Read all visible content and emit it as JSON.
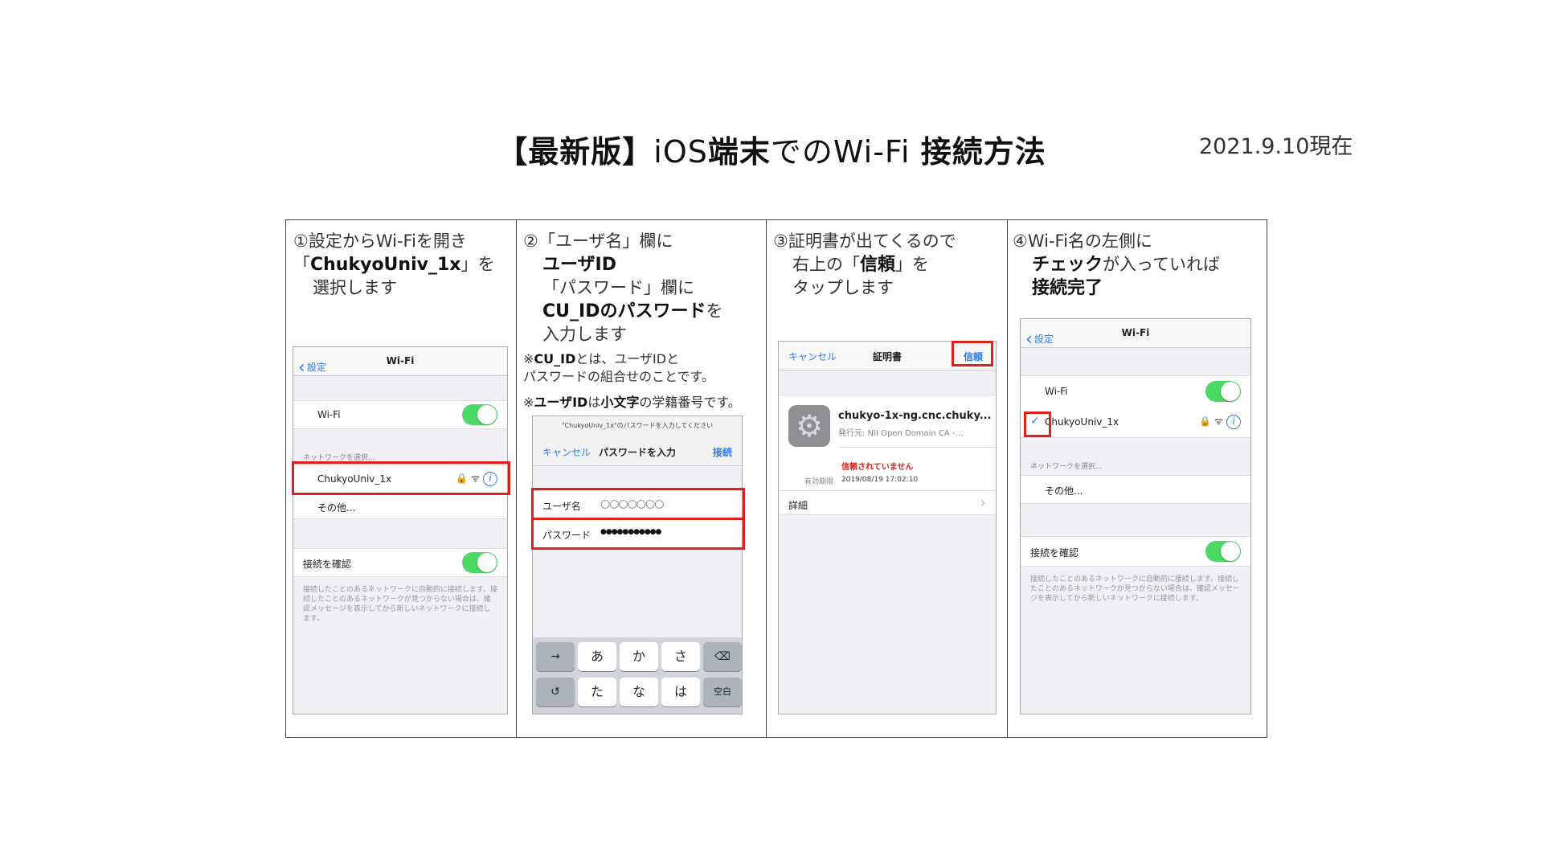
{
  "header": {
    "title_bracket": "【最新版】",
    "title_ios": "iOS",
    "title_device": "端末",
    "title_de": "での",
    "title_wifi": "Wi-Fi",
    "title_method": "接続方法",
    "date": "2021.9.10現在"
  },
  "steps": [
    {
      "line1": "①設定からWi-Fiを開き",
      "line2_a": "「",
      "line2_b": "ChukyoUniv_1x",
      "line2_c": "」を",
      "line3": "選択します",
      "screen": {
        "back": "設定",
        "title": "Wi-Fi",
        "wifi_label": "Wi-Fi",
        "section_networks": "ネットワークを選択...",
        "network_name": "ChukyoUniv_1x",
        "other": "その他...",
        "ask_join": "接続を確認",
        "footer": "接続したことのあるネットワークに自動的に接続します。接続したことのあるネットワークが見つからない場合は、確認メッセージを表示してから新しいネットワークに接続します。"
      }
    },
    {
      "line1": "②「ユーザ名」欄に",
      "line2": "ユーザID",
      "line3": "「パスワード」欄に",
      "line4_a": "CU_IDのパスワード",
      "line4_b": "を",
      "line5": "入力します",
      "note1_a": "※",
      "note1_b": "CU_ID",
      "note1_c": "とは、ユーザIDと",
      "note1_line2": "パスワードの組合せのことです。",
      "note2_a": "※",
      "note2_b": "ユーザID",
      "note2_c": "は",
      "note2_d": "小文字",
      "note2_e": "の学籍番号です。",
      "screen": {
        "prompt": "\"ChukyoUniv_1x\"のパスワードを入力してください",
        "cancel": "キャンセル",
        "title": "パスワードを入力",
        "join": "接続",
        "username_label": "ユーザ名",
        "username_value": "○○○○○○○",
        "password_label": "パスワード",
        "password_value": "●●●●●●●●●●●",
        "keys_row1": [
          "→",
          "あ",
          "か",
          "さ",
          "⌫"
        ],
        "keys_row2": [
          "↺",
          "た",
          "な",
          "は",
          "空白"
        ]
      }
    },
    {
      "line1": "③証明書が出てくるので",
      "line2_a": "右上の「",
      "line2_b": "信頼",
      "line2_c": "」を",
      "line3": "タップします",
      "screen": {
        "cancel": "キャンセル",
        "title": "証明書",
        "trust": "信頼",
        "cert_name": "chukyo-1x-ng.cnc.chuky...",
        "issuer": "発行元: NII Open Domain CA -...",
        "not_trusted": "信頼されていません",
        "expires_label": "有効期限",
        "expires_value": "2019/08/19 17:02:10",
        "details": "詳細"
      }
    },
    {
      "line1": "④Wi-Fi名の左側に",
      "line2_a": "チェック",
      "line2_b": "が入っていれば",
      "line3": "接続完了",
      "screen": {
        "back": "設定",
        "title": "Wi-Fi",
        "wifi_label": "Wi-Fi",
        "network_name": "ChukyoUniv_1x",
        "section_networks": "ネットワークを選択...",
        "other": "その他...",
        "ask_join": "接続を確認",
        "footer": "接続したことのあるネットワークに自動的に接続します。接続したことのあるネットワークが見つからない場合は、確認メッセージを表示してから新しいネットワークに接続します。"
      }
    }
  ]
}
